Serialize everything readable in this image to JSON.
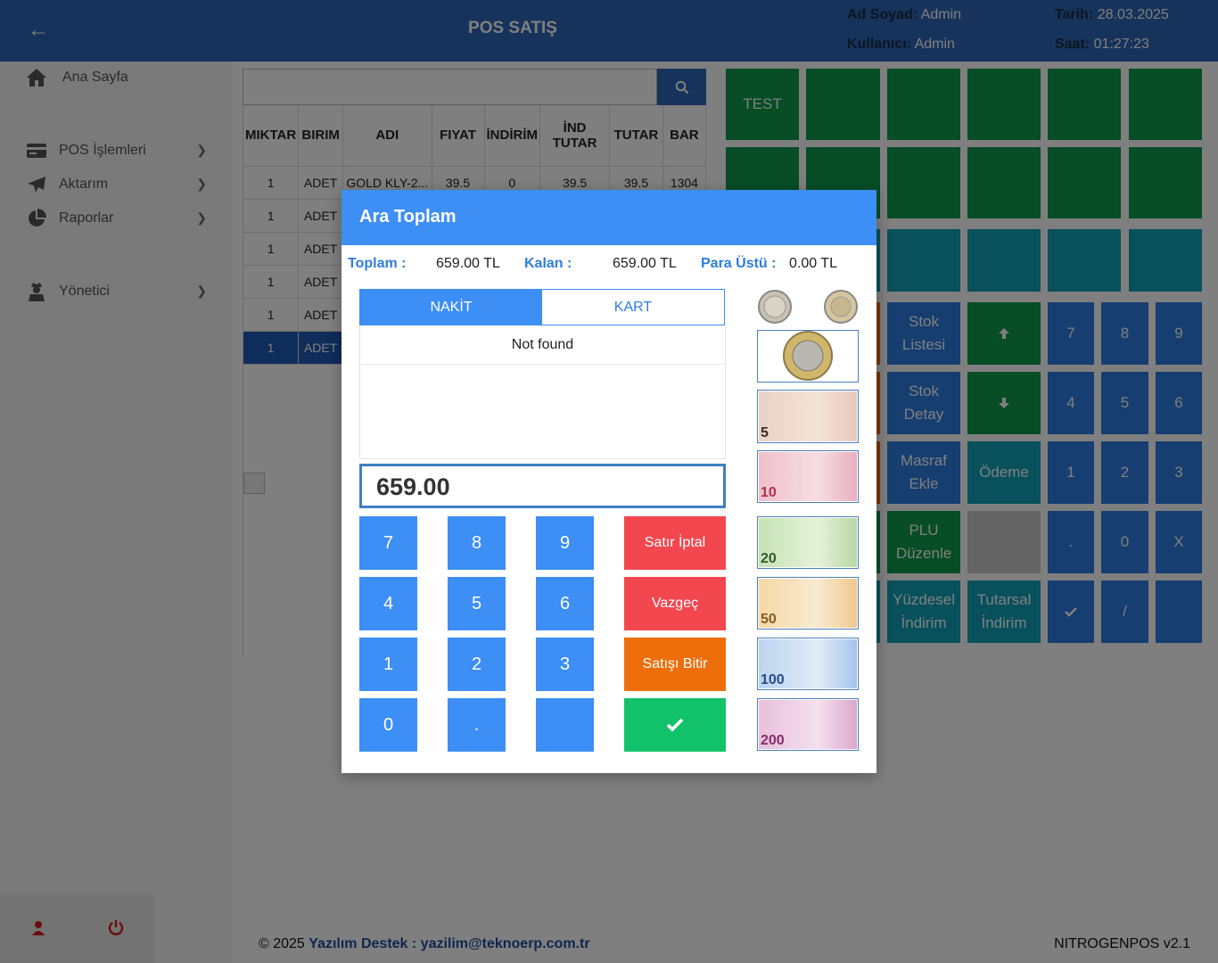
{
  "header": {
    "title": "POS SATIŞ",
    "name_label": "Ad Soyad:",
    "name_value": "Admin",
    "user_label": "Kullanıcı:",
    "user_value": "Admin",
    "date_label": "Tarih:",
    "date_value": "28.03.2025",
    "time_label": "Saat:",
    "time_value": "01:27:23"
  },
  "sidebar": {
    "home": "Ana Sayfa",
    "items": [
      {
        "label": "POS İşlemleri"
      },
      {
        "label": "Aktarım"
      },
      {
        "label": "Raporlar"
      },
      {
        "label": "Yönetici"
      }
    ]
  },
  "table": {
    "headers": [
      "MIKTAR",
      "BIRIM",
      "ADI",
      "FIYAT",
      "İNDİRİM",
      "İND TUTAR",
      "TUTAR",
      "BAR"
    ],
    "rows": [
      {
        "miktar": "1",
        "birim": "ADET",
        "adi": "GOLD KLY-2...",
        "fiyat": "39.5",
        "indirim": "0",
        "ind_tutar": "39.5",
        "tutar": "39.5",
        "bar": "1304"
      },
      {
        "miktar": "1",
        "birim": "ADET"
      },
      {
        "miktar": "1",
        "birim": "ADET"
      },
      {
        "miktar": "1",
        "birim": "ADET"
      },
      {
        "miktar": "1",
        "birim": "ADET"
      },
      {
        "miktar": "1",
        "birim": "ADET"
      }
    ]
  },
  "grid": {
    "test": "TEST",
    "stok_listesi": "Stok Listesi",
    "stok_detay": "Stok Detay",
    "masraf_ekle": "Masraf Ekle",
    "odeme": "Ödeme",
    "plu_duzenle": "PLU Düzenle",
    "yuzdesel_indirim": "Yüzdesel İndirim",
    "tutarsal_indirim": "Tutarsal İndirim",
    "keys": [
      "7",
      "8",
      "9",
      "4",
      "5",
      "6",
      "1",
      "2",
      "3",
      ".",
      "0",
      "X",
      "/"
    ]
  },
  "modal": {
    "title": "Ara Toplam",
    "toplam_label": "Toplam :",
    "toplam_value": "659.00 TL",
    "kalan_label": "Kalan :",
    "kalan_value": "659.00 TL",
    "para_ustu_label": "Para Üstü :",
    "para_ustu_value": "0.00 TL",
    "tab_nakit": "NAKİT",
    "tab_kart": "KART",
    "not_found": "Not found",
    "amount": "659.00",
    "keys": [
      "7",
      "8",
      "9",
      "4",
      "5",
      "6",
      "1",
      "2",
      "3",
      "0",
      ".",
      ""
    ],
    "satir_iptal": "Satır İptal",
    "vazgec": "Vazgeç",
    "satisi_bitir": "Satışı Bitir",
    "notes": [
      "5",
      "10",
      "20",
      "50",
      "100",
      "200"
    ],
    "colors": {
      "primary": "#3d8ef5",
      "red": "#f2474f",
      "orange": "#ee6e0c",
      "green": "#12c26a"
    }
  },
  "footer": {
    "copyright": "© 2025",
    "support": "Yazılım Destek : yazilim@teknoerp.com.tr",
    "version": "NITROGENPOS v2.1"
  }
}
